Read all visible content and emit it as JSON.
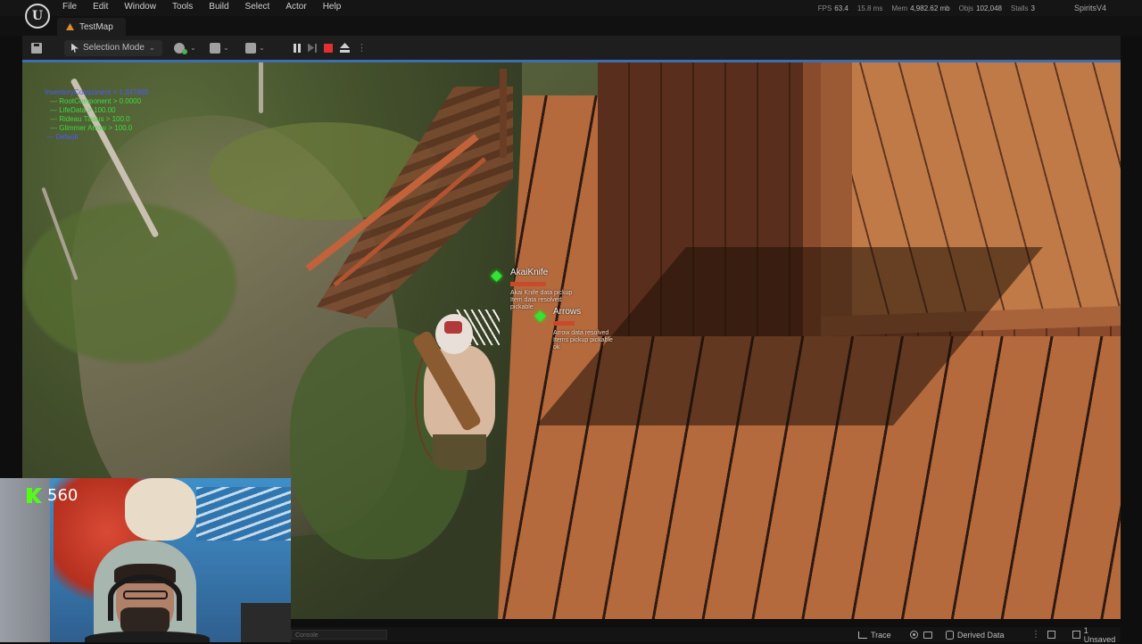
{
  "app": {
    "menu": [
      "File",
      "Edit",
      "Window",
      "Tools",
      "Build",
      "Select",
      "Actor",
      "Help"
    ],
    "stats": {
      "fps_label": "FPS",
      "fps": "63.4",
      "ms": "15.8 ms",
      "mem_label": "Mem",
      "mem": "4,982.62 mb",
      "objs_label": "Objs",
      "objs": "102,048",
      "stalls_label": "Stalls",
      "stalls": "3"
    },
    "project": "SpiritsV4"
  },
  "tabs": [
    {
      "label": "TestMap"
    }
  ],
  "toolbar": {
    "mode_label": "Selection Mode",
    "mode_chevron": "⌄",
    "more": "⋮"
  },
  "viewport": {
    "debug_lines": [
      {
        "text": "InventoryComponent > 1.347885",
        "color": "blue"
      },
      {
        "text": "--- RootComponent > 0.0000",
        "color": "green"
      },
      {
        "text": "--- LifeData > 100.00",
        "color": "green"
      },
      {
        "text": "--- Rideau Tissus > 100.0",
        "color": "green"
      },
      {
        "text": "--- Glimmer Arrow > 100.0",
        "color": "green"
      },
      {
        "text": "--- Default",
        "color": "blue"
      }
    ],
    "items": [
      {
        "name": "AkaiKnife",
        "lines": [
          "Akai Knife data pickup",
          "Item data resolved",
          "pickable"
        ]
      },
      {
        "name": "Arrows",
        "lines": [
          "Arrow data resolved",
          "Items pickup pickable",
          "ok"
        ]
      }
    ]
  },
  "statusbar": {
    "console_placeholder": "Console",
    "trace": "Trace",
    "derived_data": "Derived Data",
    "unsaved": "1 Unsaved",
    "dots": "⋮"
  },
  "webcam": {
    "kick_count": "560"
  },
  "colors": {
    "stop": "#e03030",
    "kick": "#53fc18",
    "debug_blue": "#4b5aff",
    "debug_green": "#3ddc3d",
    "viewport_border": "#3d6fb0"
  }
}
